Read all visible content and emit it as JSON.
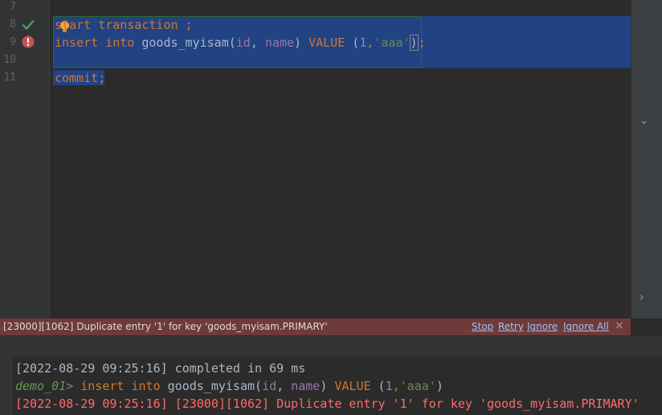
{
  "editor": {
    "line_numbers": [
      "7",
      "8",
      "9",
      "10",
      "11"
    ],
    "gutter_icons": {
      "line8": "checkmark-icon",
      "line9": "error-icon"
    },
    "line8": {
      "kw1": "start",
      "kw2": "transaction",
      "tail": " ;"
    },
    "line9": {
      "kw_insert": "insert",
      "kw_into": "into",
      "table": "goods_myisam",
      "open": "(",
      "col1": "id",
      "comma": ", ",
      "col2": "name",
      "close": ") ",
      "kw_value": "VALUE",
      "vopen": " (",
      "num": "1",
      "vcomma": ",",
      "str": "'aaa'",
      "vclose": ")",
      "semi": ";"
    },
    "line11": {
      "kw": "commit",
      "semi": ";"
    }
  },
  "error_bar": {
    "message": "[23000][1062] Duplicate entry '1' for key 'goods_myisam.PRIMARY'",
    "actions": {
      "stop": "Stop",
      "retry": "Retry",
      "ignore": "Ignore",
      "ignore_all": "Ignore All"
    },
    "close": "×"
  },
  "console": {
    "line1": "[2022-08-29 09:25:16] completed in 69 ms",
    "prompt": "demo_01>",
    "line2": {
      "kw_insert": "insert",
      "kw_into": "into",
      "table": "goods_myisam",
      "col1": "id",
      "col2": "name",
      "kw_value": "VALUE",
      "num": "1",
      "str": "'aaa'"
    },
    "line3": "[2022-08-29 09:25:16] [23000][1062] Duplicate entry '1' for key 'goods_myisam.PRIMARY'"
  },
  "colors": {
    "keyword": "#cc7832",
    "identifier": "#9876aa",
    "string": "#6a8759",
    "number": "#6897bb",
    "selection": "#214283",
    "error_bar": "#6e3a3a",
    "error_text": "#ff6b68"
  }
}
